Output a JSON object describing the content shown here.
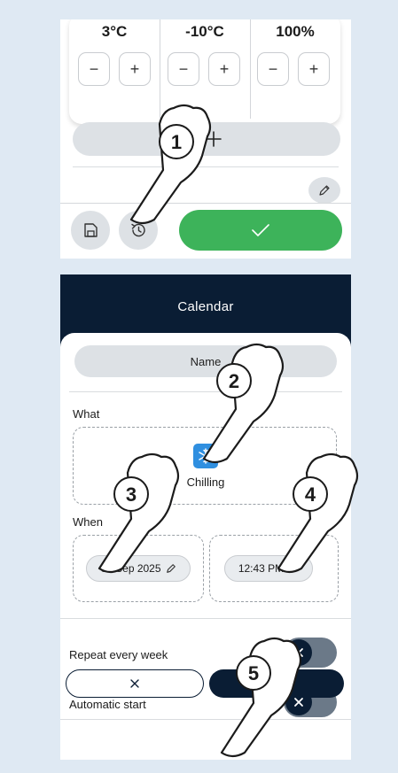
{
  "panel1": {
    "temps": [
      {
        "value": "3°C",
        "minus": "−",
        "plus": "+"
      },
      {
        "value": "-10°C",
        "minus": "−",
        "plus": "+"
      },
      {
        "value": "100%",
        "minus": "−",
        "plus": "+"
      }
    ],
    "add_icon": "plus-icon",
    "edit_icon": "pencil-icon",
    "save_icon": "save-icon",
    "history_icon": "history-icon",
    "confirm_icon": "check-icon",
    "confirm_color": "#3db35a"
  },
  "panel2": {
    "title": "Calendar",
    "name_placeholder": "Name",
    "what_label": "What",
    "program": {
      "icon": "snowflake-icon",
      "label": "Chilling"
    },
    "when_label": "When",
    "date": "01 Sep 2025",
    "time": "12:43 PM",
    "repeat_label": "Repeat every week",
    "auto_start_label": "Automatic start",
    "cancel_icon": "close-icon",
    "ok_icon": "check-icon",
    "header_color": "#0a1d34"
  },
  "callouts": [
    "1",
    "2",
    "3",
    "4",
    "5"
  ]
}
